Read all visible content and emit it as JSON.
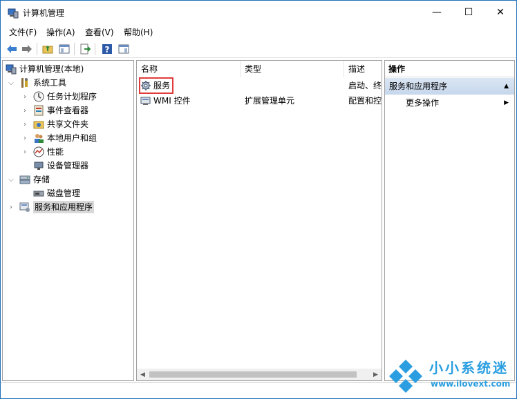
{
  "window": {
    "title": "计算机管理"
  },
  "titlebar_buttons": {
    "minimize": "—",
    "maximize": "☐",
    "close": "✕"
  },
  "menu": [
    "文件(F)",
    "操作(A)",
    "查看(V)",
    "帮助(H)"
  ],
  "tree": [
    {
      "label": "计算机管理(本地)",
      "icon": "computer-management-icon"
    },
    {
      "label": "系统工具",
      "icon": "system-tools-icon",
      "expanded": true
    },
    {
      "label": "任务计划程序",
      "icon": "task-scheduler-icon"
    },
    {
      "label": "事件查看器",
      "icon": "event-viewer-icon"
    },
    {
      "label": "共享文件夹",
      "icon": "shared-folders-icon"
    },
    {
      "label": "本地用户和组",
      "icon": "local-users-icon"
    },
    {
      "label": "性能",
      "icon": "performance-icon"
    },
    {
      "label": "设备管理器",
      "icon": "device-manager-icon"
    },
    {
      "label": "存储",
      "icon": "storage-icon",
      "expanded": true
    },
    {
      "label": "磁盘管理",
      "icon": "disk-management-icon"
    },
    {
      "label": "服务和应用程序",
      "icon": "services-apps-icon",
      "selected": true
    }
  ],
  "list": {
    "columns": [
      "名称",
      "类型",
      "描述"
    ],
    "rows": [
      {
        "name": "服务",
        "type": "",
        "desc": "启动、终",
        "icon": "gear-icon",
        "highlighted": true
      },
      {
        "name": "WMI 控件",
        "type": "扩展管理单元",
        "desc": "配置和控",
        "icon": "wmi-icon"
      }
    ]
  },
  "actions": {
    "header": "操作",
    "section": "服务和应用程序",
    "items": [
      "更多操作"
    ]
  },
  "watermark": {
    "brand": "小小系统迷",
    "url": "www.ilovext.com"
  },
  "colors": {
    "accent": "#1d6fb8",
    "highlight": "#e23a3a",
    "brand": "#2a9ee0"
  }
}
